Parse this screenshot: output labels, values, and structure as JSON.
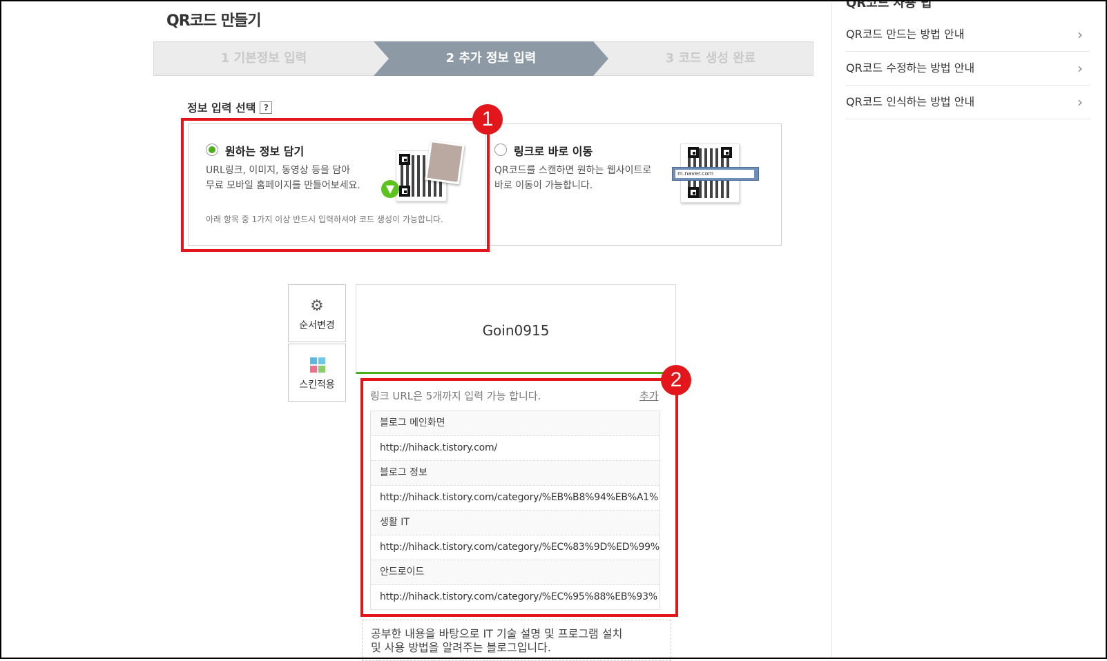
{
  "page": {
    "title": "QR코드 만들기"
  },
  "steps": [
    {
      "label": "1 기본정보 입력"
    },
    {
      "label": "2 추가 정보 입력"
    },
    {
      "label": "3 코드 생성 완료"
    }
  ],
  "selection": {
    "label": "정보 입력 선택",
    "help": "?",
    "option1": {
      "title": "원하는 정보 담기",
      "desc_line1": "URL링크, 이미지, 동영상 등을 담아",
      "desc_line2": "무료 모바일 홈페이지를 만들어보세요.",
      "note": "아래 항목 중 1가지 이상 반드시 입력하셔야 코드 생성이 가능합니다."
    },
    "option2": {
      "title": "링크로 바로 이동",
      "desc_line1": "QR코드를 스캔하면 원하는 웹사이트로",
      "desc_line2": "바로 이동이 가능합니다.",
      "url_sample": "m.naver.com"
    }
  },
  "annotations": {
    "one": "1",
    "two": "2"
  },
  "tools": {
    "reorder": "순서변경",
    "skin": "스킨적용"
  },
  "card": {
    "name": "Goin0915"
  },
  "links": {
    "header": "링크 URL은 5개까지 입력 가능 합니다.",
    "add": "추가",
    "items": [
      {
        "title": "블로그 메인화면",
        "url": "http://hihack.tistory.com/"
      },
      {
        "title": "블로그 정보",
        "url": "http://hihack.tistory.com/category/%EB%B8%94%EB%A1%"
      },
      {
        "title": "생활 IT",
        "url": "http://hihack.tistory.com/category/%EC%83%9D%ED%99%"
      },
      {
        "title": "안드로이드",
        "url": "http://hihack.tistory.com/category/%EC%95%88%EB%93%"
      }
    ]
  },
  "description": {
    "line1": "공부한 내용을 바탕으로 IT 기술 설명 및 프로그램 설치",
    "line2": "및 사용 방법을 알려주는 블로그입니다."
  },
  "sidebar": {
    "title": "QR코드 사용 팁",
    "items": [
      {
        "label": "QR코드 만드는 방법 안내"
      },
      {
        "label": "QR코드 수정하는 방법 안내"
      },
      {
        "label": "QR코드 인식하는 방법 안내"
      }
    ]
  },
  "colors": {
    "accent_green": "#44b01a",
    "annotation_red": "#e3161b",
    "step_active": "#8d9aa6"
  }
}
